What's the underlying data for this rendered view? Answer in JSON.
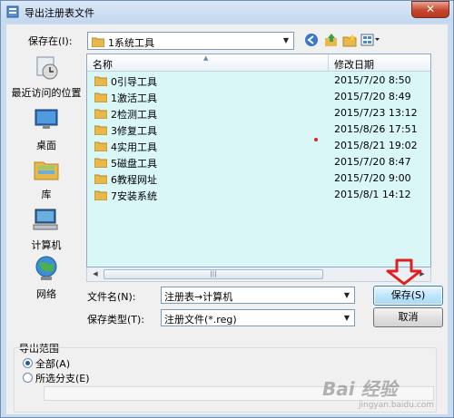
{
  "window": {
    "title": "导出注册表文件",
    "close_label": "✕"
  },
  "save_in": {
    "label": "保存在(I):",
    "value": "1系统工具"
  },
  "places": [
    {
      "label": "最近访问的位置",
      "icon": "recent-places-icon"
    },
    {
      "label": "桌面",
      "icon": "desktop-icon"
    },
    {
      "label": "库",
      "icon": "libraries-icon"
    },
    {
      "label": "计算机",
      "icon": "computer-icon"
    },
    {
      "label": "网络",
      "icon": "network-icon"
    }
  ],
  "file_list": {
    "columns": {
      "name": "名称",
      "date": "修改日期"
    },
    "rows": [
      {
        "name": "0引导工具",
        "date": "2015/7/20 8:50"
      },
      {
        "name": "1激活工具",
        "date": "2015/7/20 8:49"
      },
      {
        "name": "2检测工具",
        "date": "2015/7/23 13:12"
      },
      {
        "name": "3修复工具",
        "date": "2015/8/26 17:51"
      },
      {
        "name": "4实用工具",
        "date": "2015/8/21 19:02"
      },
      {
        "name": "5磁盘工具",
        "date": "2015/7/20 8:47"
      },
      {
        "name": "6教程网址",
        "date": "2015/7/20 9:00"
      },
      {
        "name": "7安装系统",
        "date": "2015/8/1 14:12"
      }
    ]
  },
  "filename": {
    "label": "文件名(N):",
    "value": "注册表→计算机"
  },
  "filetype": {
    "label": "保存类型(T):",
    "value": "注册文件(*.reg)"
  },
  "buttons": {
    "save": "保存(S)",
    "cancel": "取消"
  },
  "export_range": {
    "label": "导出范围",
    "options": [
      {
        "label": "全部(A)",
        "selected": true
      },
      {
        "label": "所选分支(E)",
        "selected": false
      }
    ]
  },
  "watermark": {
    "main": "Bai 经验",
    "sub": "jingyan.baidu.com"
  },
  "colors": {
    "list_bg": "#d9f7f7",
    "accent": "#3c7fb1",
    "arrow": "#e02020"
  }
}
